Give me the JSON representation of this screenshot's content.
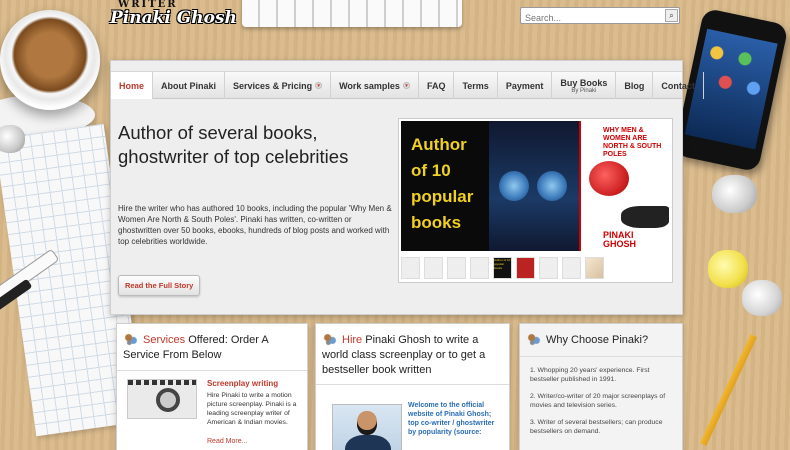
{
  "logo": {
    "top": "WRITER",
    "name": "Pinaki Ghosh"
  },
  "search": {
    "placeholder": "Search...",
    "button": "⌕"
  },
  "nav": {
    "items": [
      {
        "label": "Home",
        "active": true
      },
      {
        "label": "About Pinaki"
      },
      {
        "label": "Services & Pricing",
        "has_sub": true
      },
      {
        "label": "Work samples",
        "has_sub": true
      },
      {
        "label": "FAQ"
      },
      {
        "label": "Terms"
      },
      {
        "label": "Payment"
      },
      {
        "label": "Buy Books",
        "sub": "By Pinaki"
      },
      {
        "label": "Blog"
      },
      {
        "label": "Contact"
      }
    ],
    "arrow": "▾"
  },
  "hero": {
    "title": "Author of several books, ghostwriter of top celebrities",
    "text": "Hire the writer who has authored 10 books, including the popular 'Why Men & Women Are North & South Poles'. Pinaki has written, co-written or ghostwritten over 50 books, ebooks, hundreds of blog posts and worked with top celebrities worldwide.",
    "button": "Read the Full Story"
  },
  "slider": {
    "book1": [
      "Author",
      "of 10",
      "popular",
      "books"
    ],
    "book2_title": "WHY MEN & WOMEN ARE NORTH & SOUTH POLES",
    "book2_author": [
      "PINAKI",
      "GHOSH"
    ],
    "thumb_text": "Author of 10 popular books"
  },
  "services": {
    "heading_hl": "Services",
    "heading_rest": " Offered: Order A Service From Below",
    "item_title": "Screenplay writing",
    "item_text": "Hire Pinaki to write a motion picture screenplay. Pinaki is a leading screenplay writer of American & Indian movies.",
    "read_more": "Read More..."
  },
  "hire": {
    "heading_hl": "Hire",
    "heading_rest": " Pinaki Ghosh to write a world class screenplay or to get a bestseller book written",
    "welcome": "Welcome to the official website of Pinaki Ghosh; top co-writer / ghostwriter by popularity (source:"
  },
  "why": {
    "heading": "Why Choose Pinaki?",
    "points": [
      "1. Whopping 20 years' experience. First bestseller published in 1991.",
      "2. Writer/co-writer of 20 major screenplays of movies and television series.",
      "3. Writer of several bestsellers; can produce bestsellers on demand."
    ]
  },
  "colors": {
    "accent": "#c0392b",
    "link_blue": "#2a6db5",
    "book_yellow": "#f0d020"
  }
}
